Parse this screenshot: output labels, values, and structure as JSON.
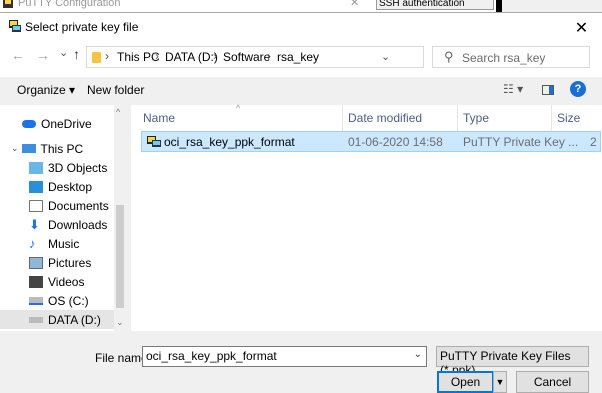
{
  "background_window": {
    "title": "PuTTY Configuration",
    "ssh_label": "SSH authentication"
  },
  "dialog": {
    "title": "Select private key file",
    "close": "✕"
  },
  "nav": {
    "back": "←",
    "forward": "→",
    "recent": "⌄",
    "up": "↑",
    "breadcrumb": [
      "This PC",
      "DATA (D:)",
      "Software",
      "rsa_key"
    ],
    "separator": "›",
    "refresh": "↻",
    "search_placeholder": "Search rsa_key"
  },
  "toolbar": {
    "organize": "Organize ▾",
    "new_folder": "New folder",
    "view": "☷ ▾",
    "help": "?"
  },
  "tree": [
    {
      "label": "OneDrive",
      "icon": "cloud-icon"
    },
    {
      "label": "This PC",
      "icon": "computer-icon"
    },
    {
      "label": "3D Objects",
      "icon": "cube-icon"
    },
    {
      "label": "Desktop",
      "icon": "desktop-icon"
    },
    {
      "label": "Documents",
      "icon": "document-icon"
    },
    {
      "label": "Downloads",
      "icon": "download-icon"
    },
    {
      "label": "Music",
      "icon": "music-icon"
    },
    {
      "label": "Pictures",
      "icon": "picture-icon"
    },
    {
      "label": "Videos",
      "icon": "video-icon"
    },
    {
      "label": "OS (C:)",
      "icon": "drive-icon"
    },
    {
      "label": "DATA (D:)",
      "icon": "drive-icon"
    }
  ],
  "columns": {
    "name": "Name",
    "date": "Date modified",
    "type": "Type",
    "size": "Size"
  },
  "files": [
    {
      "name": "oci_rsa_key_ppk_format",
      "date": "01-06-2020 14:58",
      "type": "PuTTY Private Key ...",
      "size": "2"
    }
  ],
  "footer": {
    "file_name_label": "File name:",
    "file_name_value": "oci_rsa_key_ppk_format",
    "file_type": "PuTTY Private Key Files (*.ppk)",
    "open": "Open",
    "cancel": "Cancel"
  },
  "colors": {
    "selection": "#cce8ff",
    "accent": "#0078d7",
    "help": "#1a6fd6"
  }
}
